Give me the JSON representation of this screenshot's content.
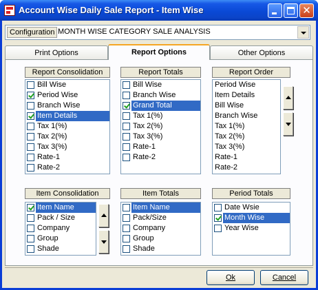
{
  "window": {
    "title": "Account Wise Daily Sale Report - Item Wise"
  },
  "config": {
    "label": "Configuration",
    "value": "MONTH WISE CATEGORY SALE ANALYSIS"
  },
  "tabs": [
    {
      "label": "Print Options",
      "active": false
    },
    {
      "label": "Report Options",
      "active": true
    },
    {
      "label": "Other Options",
      "active": false
    }
  ],
  "report_consolidation": {
    "title": "Report Consolidation",
    "items": [
      {
        "label": "Bill Wise",
        "checked": false,
        "selected": false
      },
      {
        "label": "Period Wise",
        "checked": true,
        "selected": false
      },
      {
        "label": "Branch Wise",
        "checked": false,
        "selected": false
      },
      {
        "label": "Item Details",
        "checked": true,
        "selected": true
      },
      {
        "label": "Tax 1(%)",
        "checked": false,
        "selected": false
      },
      {
        "label": "Tax 2(%)",
        "checked": false,
        "selected": false
      },
      {
        "label": "Tax 3(%)",
        "checked": false,
        "selected": false
      },
      {
        "label": "Rate-1",
        "checked": false,
        "selected": false
      },
      {
        "label": "Rate-2",
        "checked": false,
        "selected": false
      }
    ]
  },
  "report_totals": {
    "title": "Report Totals",
    "items": [
      {
        "label": "Bill Wise",
        "checked": false,
        "selected": false
      },
      {
        "label": "Branch Wise",
        "checked": false,
        "selected": false
      },
      {
        "label": "Grand Total",
        "checked": true,
        "selected": true
      },
      {
        "label": "Tax 1(%)",
        "checked": false,
        "selected": false
      },
      {
        "label": "Tax 2(%)",
        "checked": false,
        "selected": false
      },
      {
        "label": "Tax 3(%)",
        "checked": false,
        "selected": false
      },
      {
        "label": "Rate-1",
        "checked": false,
        "selected": false
      },
      {
        "label": "Rate-2",
        "checked": false,
        "selected": false
      }
    ]
  },
  "report_order": {
    "title": "Report Order",
    "items": [
      "Period Wise",
      "Item Details",
      "Bill Wise",
      "Branch Wise",
      "Tax 1(%)",
      "Tax 2(%)",
      "Tax 3(%)",
      "Rate-1",
      "Rate-2"
    ]
  },
  "item_consolidation": {
    "title": "Item Consolidation",
    "items": [
      {
        "label": "Item Name",
        "checked": true,
        "selected": true
      },
      {
        "label": "Pack / Size",
        "checked": false,
        "selected": false
      },
      {
        "label": "Company",
        "checked": false,
        "selected": false
      },
      {
        "label": "Group",
        "checked": false,
        "selected": false
      },
      {
        "label": "Shade",
        "checked": false,
        "selected": false
      }
    ]
  },
  "item_totals": {
    "title": "Item Totals",
    "items": [
      {
        "label": "Item Name",
        "checked": false,
        "selected": true
      },
      {
        "label": "Pack/Size",
        "checked": false,
        "selected": false
      },
      {
        "label": "Company",
        "checked": false,
        "selected": false
      },
      {
        "label": "Group",
        "checked": false,
        "selected": false
      },
      {
        "label": "Shade",
        "checked": false,
        "selected": false
      }
    ]
  },
  "period_totals": {
    "title": "Period Totals",
    "items": [
      {
        "label": "Date Wsie",
        "checked": false,
        "selected": false
      },
      {
        "label": "Month Wise",
        "checked": true,
        "selected": true
      },
      {
        "label": "Year Wise",
        "checked": false,
        "selected": false
      }
    ]
  },
  "buttons": {
    "ok": "Ok",
    "cancel": "Cancel"
  },
  "colors": {
    "title_bar": "#0a49d6",
    "selection": "#316ac5",
    "dialog_bg": "#ece9d8",
    "check": "#21a121"
  }
}
